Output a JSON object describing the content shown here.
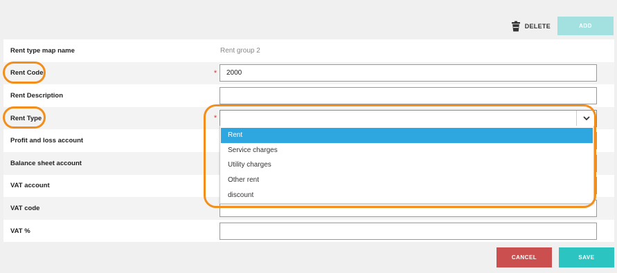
{
  "toolbar": {
    "delete_label": "DELETE",
    "add_label": "ADD"
  },
  "form": {
    "rent_type_map_name": {
      "label": "Rent type map name",
      "value": "Rent group 2"
    },
    "rent_code": {
      "label": "Rent Code",
      "value": "2000",
      "required": "*"
    },
    "rent_description": {
      "label": "Rent Description",
      "value": ""
    },
    "rent_type": {
      "label": "Rent Type",
      "value": "",
      "required": "*"
    },
    "profit_loss": {
      "label": "Profit and loss account"
    },
    "balance_sheet": {
      "label": "Balance sheet account"
    },
    "vat_account": {
      "label": "VAT account"
    },
    "vat_code": {
      "label": "VAT code"
    },
    "vat_percent": {
      "label": "VAT %",
      "value": ""
    }
  },
  "rent_type_options": [
    "Rent",
    "Service charges",
    "Utility charges",
    "Other rent",
    "discount"
  ],
  "selected_option": "Rent",
  "footer": {
    "cancel_label": "CANCEL",
    "save_label": "SAVE"
  },
  "colors": {
    "accent": "#2ea6df",
    "highlight": "#f28e1c",
    "save": "#2cc4c1",
    "cancel": "#cc4f4f",
    "add": "#a3e1e0"
  }
}
